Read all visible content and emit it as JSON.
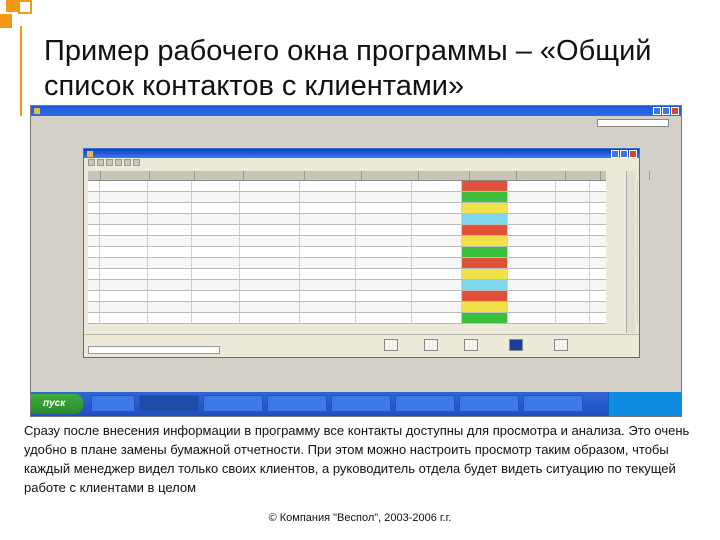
{
  "slide": {
    "title": "Пример рабочего окна программы – «Общий список контактов с клиентами»",
    "description": "Сразу после внесения информации в программу все контакты доступны для просмотра и анализа. Это очень удобно в плане замены бумажной отчетности. При этом можно настроить просмотр таким образом, чтобы каждый менеджер видел только своих клиентов, а руководитель отдела будет видеть ситуацию по текущей работе с клиентами в целом",
    "footer": "© Компания \"Веспол\", 2003-2006 г.г."
  },
  "app": {
    "taskbar": {
      "start_label": "пуск"
    }
  },
  "colors": {
    "accent": "#f29a16",
    "titlebar": "#1c5bd6",
    "taskbar": "#3168d5",
    "status_red": "#e0513a",
    "status_green": "#3cbf3c",
    "status_cyan": "#7fd7ee",
    "status_yellow": "#f2e24a"
  },
  "icons": [
    "app-icon",
    "minimize-icon",
    "maximize-icon",
    "close-icon",
    "start-icon",
    "toolbar-icons"
  ]
}
